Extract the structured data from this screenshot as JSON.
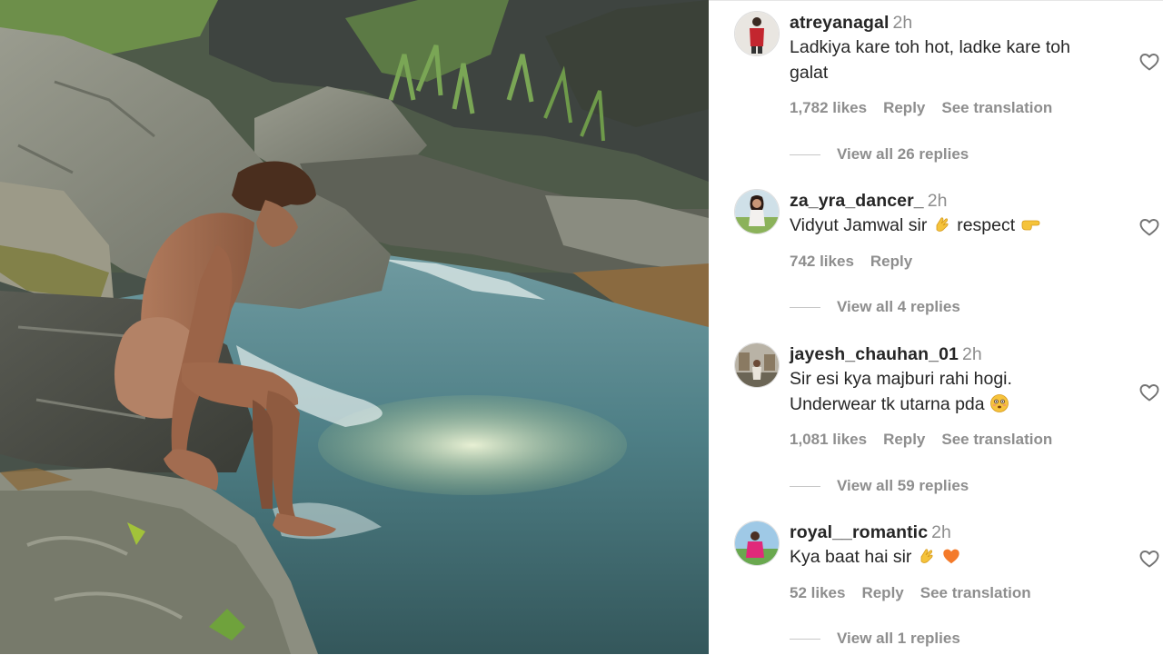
{
  "comments": [
    {
      "username": "atreyanagal",
      "time": "2h",
      "text_lines": [
        "Ladkiya kare toh hot, ladke kare toh",
        "galat"
      ],
      "likes": "1,782 likes",
      "reply": "Reply",
      "translation": "See translation",
      "view_replies": "View all 26 replies",
      "emoji_icons": []
    },
    {
      "username": "za_yra_dancer_",
      "time": "2h",
      "text_parts": [
        "Vidyut Jamwal sir",
        "respect"
      ],
      "likes": "742 likes",
      "reply": "Reply",
      "view_replies": "View all 4 replies",
      "emoji_icons": [
        "clapping-hands-emoji",
        "pointing-right-emoji"
      ]
    },
    {
      "username": "jayesh_chauhan_01",
      "time": "2h",
      "text_lines": [
        "Sir esi kya majburi rahi hogi.",
        "Underwear tk utarna pda"
      ],
      "likes": "1,081 likes",
      "reply": "Reply",
      "translation": "See translation",
      "view_replies": "View all 59 replies",
      "emoji_icons": [
        "flushed-face-emoji"
      ]
    },
    {
      "username": "royal__romantic",
      "time": "2h",
      "text_parts": [
        "Kya baat hai sir"
      ],
      "likes": "52 likes",
      "reply": "Reply",
      "translation": "See translation",
      "view_replies": "View all 1 replies",
      "emoji_icons": [
        "clapping-hands-emoji",
        "orange-heart-emoji"
      ]
    }
  ],
  "icons": {
    "like": "heart-outline-icon"
  },
  "colors": {
    "text": "#262626",
    "secondary": "#8e8e8e",
    "divider": "#c7c7c7"
  }
}
